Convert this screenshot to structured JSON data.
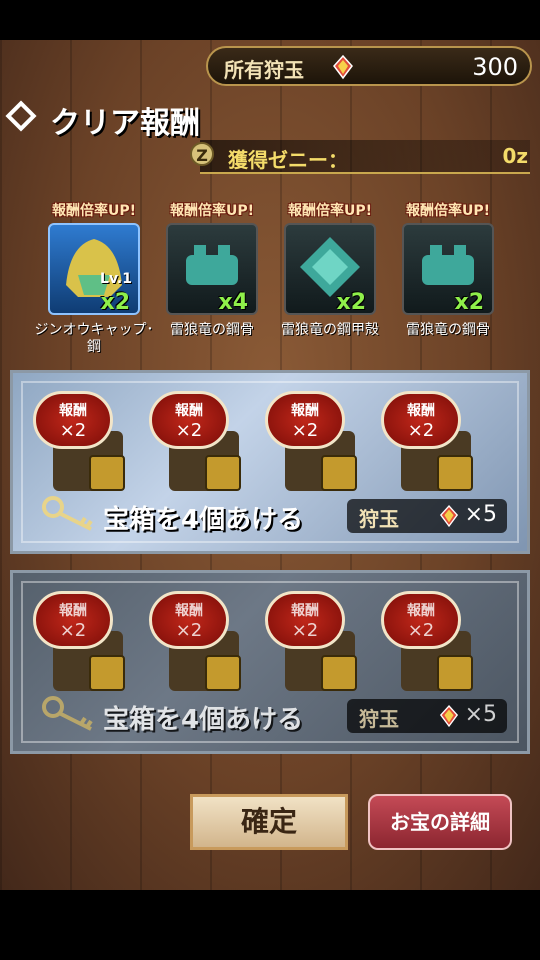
{
  "currency": {
    "label": "所有狩玉",
    "value": "300"
  },
  "section": {
    "title": "クリア報酬"
  },
  "zeny": {
    "icon_letter": "Z",
    "label": "獲得ゼニー：",
    "value": "0z"
  },
  "rewards": [
    {
      "bonus": "報酬倍率UP!",
      "name": "ジンオウキャップ･鋼",
      "qty": "x2",
      "level": "Lv.1",
      "icon": "helmet-icon"
    },
    {
      "bonus": "報酬倍率UP!",
      "name": "雷狼竜の鋼骨",
      "qty": "x4",
      "icon": "bone-icon"
    },
    {
      "bonus": "報酬倍率UP!",
      "name": "雷狼竜の鋼甲殻",
      "qty": "x2",
      "icon": "shell-icon"
    },
    {
      "bonus": "報酬倍率UP!",
      "name": "雷狼竜の鋼骨",
      "qty": "x2",
      "icon": "bone-icon"
    }
  ],
  "chest_badge": {
    "text": "報酬",
    "mult": "×2"
  },
  "options": [
    {
      "label": "宝箱を4個あける",
      "cost_label": "狩玉",
      "cost_mult": "×5"
    },
    {
      "label": "宝箱を4個あける",
      "cost_label": "狩玉",
      "cost_mult": "×5"
    }
  ],
  "buttons": {
    "confirm": "確定",
    "details": "お宝の詳細"
  },
  "colors": {
    "gold": "#c9a84e",
    "green_qty": "#8ff04a",
    "red_badge": "#c0271a"
  }
}
